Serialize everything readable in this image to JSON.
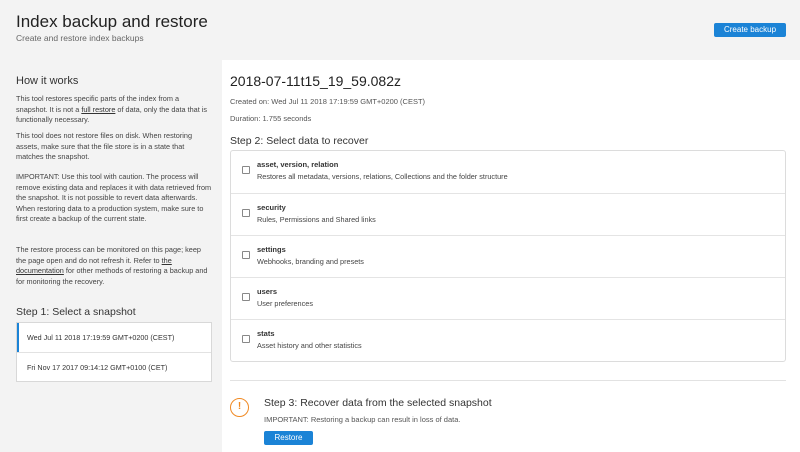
{
  "header": {
    "title": "Index backup and restore",
    "subtitle": "Create and restore index backups",
    "create_label": "Create backup"
  },
  "sidebar": {
    "how_title": "How it works",
    "p1_a": "This tool restores specific parts of the index from a snapshot. It is not a ",
    "p1_link": "full restore",
    "p1_b": " of data, only the data that is functionally necessary.",
    "p2": "This tool does not restore files on disk. When restoring assets, make sure that the file store is in a state that matches the snapshot.",
    "p3": "IMPORTANT: Use this tool with caution. The process will remove existing data and replaces it with data retrieved from the snapshot. It is not possible to revert data afterwards. When restoring data to a production system, make sure to first create a backup of the current state.",
    "p4_a": "The restore process can be monitored on this page; keep the page open and do not refresh it. Refer to ",
    "p4_link": "the documentation",
    "p4_b": " for other methods of restoring a backup and for monitoring the recovery.",
    "step1_title": "Step 1: Select a snapshot",
    "snapshots": [
      {
        "label": "Wed Jul 11 2018 17:19:59 GMT+0200 (CEST)",
        "selected": true
      },
      {
        "label": "Fri Nov 17 2017 09:14:12 GMT+0100 (CET)",
        "selected": false
      }
    ]
  },
  "main": {
    "snapshot_title": "2018-07-11t15_19_59.082z",
    "created": "Created on: Wed Jul 11 2018 17:19:59 GMT+0200 (CEST)",
    "duration": "Duration: 1.755 seconds",
    "step2_title": "Step 2: Select data to recover",
    "items": [
      {
        "name": "asset, version, relation",
        "desc": "Restores all metadata, versions, relations, Collections and the folder structure"
      },
      {
        "name": "security",
        "desc": "Rules, Permissions and Shared links"
      },
      {
        "name": "settings",
        "desc": "Webhooks, branding and presets"
      },
      {
        "name": "users",
        "desc": "User preferences"
      },
      {
        "name": "stats",
        "desc": "Asset history and other statistics"
      }
    ],
    "step3_title": "Step 3: Recover data from the selected snapshot",
    "step3_important": "IMPORTANT:",
    "step3_warning": " Restoring a backup can result in loss of data.",
    "warn_glyph": "!",
    "restore_label": "Restore"
  },
  "colors": {
    "accent": "#1b83d6",
    "warning": "#f08a24",
    "panel_bg": "#f3f3f3"
  },
  "icons": [
    "warning-icon",
    "checkbox"
  ]
}
